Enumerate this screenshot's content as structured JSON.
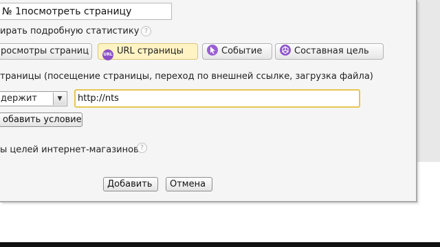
{
  "form": {
    "goal_name_value": "№ 1посмотреть страницу",
    "stat_label": "ирать подробную статистику",
    "help_glyph": "?"
  },
  "tabs": [
    {
      "label": "росмотры страниц",
      "icon": "",
      "active": false
    },
    {
      "label": "URL страницы",
      "icon": "url-icon",
      "icon_text": "URL",
      "active": true
    },
    {
      "label": "Событие",
      "icon": "cursor-arrow-icon",
      "active": false
    },
    {
      "label": "Составная цель",
      "icon": "composite-goal-icon",
      "active": false
    }
  ],
  "condition": {
    "description": "траницы (посещение страницы, переход по внешней ссылке, загрузка файла)",
    "select_value": "держит",
    "url_value": "http://nts",
    "add_condition_label": "обавить условие"
  },
  "ecommerce": {
    "label": "ы целей интернет-магазинов"
  },
  "footer": {
    "add_label": "Добавить",
    "cancel_label": "Отмена"
  },
  "colors": {
    "active_tab": "#fff3c4",
    "url_input_border": "#e7c650",
    "icon_purple": "#8b4fc7"
  }
}
